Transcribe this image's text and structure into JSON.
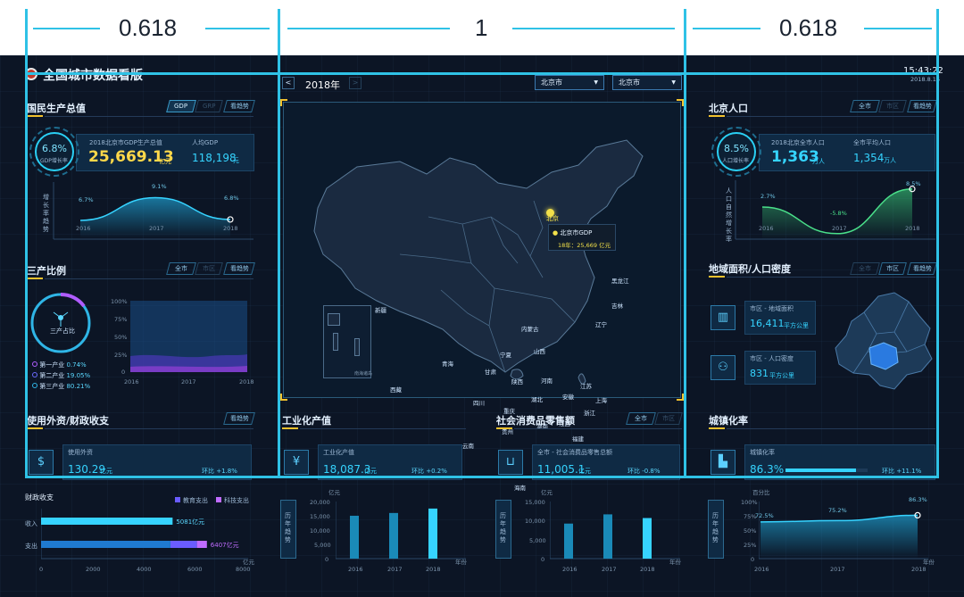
{
  "ratios": {
    "left": "0.618",
    "center": "1",
    "right": "0.618"
  },
  "header": {
    "title": "全国城市数据看版",
    "time": "15:43:22",
    "date": "2018.8.15"
  },
  "year_nav": {
    "year": "2018年",
    "prev": "<",
    "next": ">"
  },
  "selects": [
    {
      "value": "北京市"
    },
    {
      "value": "北京市"
    }
  ],
  "gdp": {
    "title": "国民生产总值",
    "buttons": [
      "GDP",
      "GRP",
      "看趋势"
    ],
    "rate": "6.8%",
    "rate_label": "GDP增长率",
    "total_label": "2018北京市GDP生产总值",
    "total": "25,669.13",
    "total_unit": "亿元",
    "per_label": "人均GDP",
    "per": "118,198",
    "per_unit": "元",
    "trend_label": "增长率趋势"
  },
  "gdp_trend": {
    "type": "area",
    "x": [
      "2016",
      "2017",
      "2018"
    ],
    "values": [
      6.7,
      9.1,
      6.8
    ],
    "labels": [
      "6.7%",
      "9.1%",
      "6.8%"
    ]
  },
  "industry": {
    "title": "三产比例",
    "buttons": [
      "全市",
      "市区",
      "看趋势"
    ],
    "center_label": "三产占比",
    "legend": [
      {
        "name": "第一产业",
        "value": "0.74%",
        "color": "#b05cff"
      },
      {
        "name": "第二产业",
        "value": "19.05%",
        "color": "#6a6aff"
      },
      {
        "name": "第三产业",
        "value": "80.21%",
        "color": "#2fb5e6"
      }
    ]
  },
  "industry_chart": {
    "type": "area",
    "x": [
      "2016",
      "2017",
      "2018"
    ],
    "yticks": [
      "100%",
      "75%",
      "50%",
      "25%",
      "0"
    ]
  },
  "foreign": {
    "title": "使用外资/财政收支",
    "button": "看趋势",
    "label": "使用外资",
    "value": "130.29",
    "unit": "亿元",
    "change": "环比 +1.8%"
  },
  "finance": {
    "title": "财政收支",
    "legend": [
      "教育支出",
      "科技支出"
    ],
    "rows": [
      {
        "name": "收入",
        "value": 5081,
        "label": "5081亿元"
      },
      {
        "name": "支出",
        "value": 6407,
        "label": "6407亿元"
      }
    ],
    "xticks": [
      "0",
      "2000",
      "4000",
      "6000",
      "8000"
    ],
    "unit": "亿元"
  },
  "industrial": {
    "title": "工业化产值",
    "label": "工业化产值",
    "value": "18,087.3",
    "unit": "亿元",
    "change": "环比 +0.2%",
    "trend_label": "历年趋势"
  },
  "industrial_chart": {
    "type": "bar",
    "unit": "亿元",
    "categories": [
      "2016",
      "2017",
      "2018"
    ],
    "values": [
      15500,
      16500,
      18100
    ],
    "yticks": [
      "20,000",
      "15,000",
      "10,000",
      "5,000",
      "0"
    ],
    "ylim": [
      0,
      20000
    ],
    "xunit": "年份"
  },
  "consumer": {
    "title": "社会消费品零售额",
    "buttons": [
      "全市",
      "市区"
    ],
    "label": "全市 - 社会消费品零售总额",
    "value": "11,005.1",
    "unit": "亿元",
    "change": "环比 -0.8%",
    "trend_label": "历年趋势"
  },
  "consumer_chart": {
    "type": "bar",
    "unit": "亿元",
    "categories": [
      "2016",
      "2017",
      "2018"
    ],
    "values": [
      9500,
      12000,
      11000
    ],
    "yticks": [
      "15,000",
      "10,000",
      "5,000",
      "0"
    ],
    "ylim": [
      0,
      15000
    ],
    "xunit": "年份"
  },
  "population": {
    "title": "北京人口",
    "buttons": [
      "全市",
      "市区",
      "看趋势"
    ],
    "rate": "8.5%",
    "rate_label": "人口增长率",
    "total_label": "2018北京全市人口",
    "total": "1,363",
    "total_unit": "万人",
    "avg_label": "全市平均人口",
    "avg": "1,354",
    "avg_unit": "万人",
    "trend_label": "人口自然增长率"
  },
  "pop_trend": {
    "type": "line",
    "x": [
      "2016",
      "2017",
      "2018"
    ],
    "values": [
      2.7,
      -5.8,
      8.5
    ],
    "labels": [
      "2.7%",
      "-5.8%",
      "8.5%"
    ]
  },
  "area": {
    "title": "地域面积/人口密度",
    "buttons": [
      "全市",
      "市区",
      "看趋势"
    ],
    "area_label": "市区 - 地域面积",
    "area_value": "16,411",
    "area_unit": "平方公里",
    "density_label": "市区 - 人口密度",
    "density_value": "831",
    "density_unit": "平方公里"
  },
  "urban": {
    "title": "城镇化率",
    "label": "城镇化率",
    "value": "86.3%",
    "change": "环比 +11.1%",
    "progress": 0.863
  },
  "urban_chart": {
    "type": "area",
    "unit": "百分比",
    "x": [
      "2016",
      "2017",
      "2018"
    ],
    "values": [
      72.5,
      75.2,
      86.3
    ],
    "labels": [
      "72.5%",
      "75.2%",
      "86.3%"
    ],
    "yticks": [
      "100%",
      "75%",
      "50%",
      "25%",
      "0"
    ],
    "xunit": "年份"
  },
  "map": {
    "tooltip_city": "北京",
    "tooltip_title": "北京市GDP",
    "tooltip_value": "18年：25,669 亿元",
    "inset_label": "南海诸岛",
    "provinces": [
      {
        "n": "新疆",
        "x": 420,
        "y": 218
      },
      {
        "n": "西藏",
        "x": 437,
        "y": 307
      },
      {
        "n": "青海",
        "x": 495,
        "y": 278
      },
      {
        "n": "甘肃",
        "x": 543,
        "y": 287
      },
      {
        "n": "内蒙古",
        "x": 584,
        "y": 239
      },
      {
        "n": "宁夏",
        "x": 560,
        "y": 268
      },
      {
        "n": "山西",
        "x": 598,
        "y": 264
      },
      {
        "n": "陕西",
        "x": 573,
        "y": 298
      },
      {
        "n": "四川",
        "x": 530,
        "y": 322
      },
      {
        "n": "重庆",
        "x": 564,
        "y": 331
      },
      {
        "n": "湖北",
        "x": 595,
        "y": 318
      },
      {
        "n": "河南",
        "x": 606,
        "y": 297
      },
      {
        "n": "安徽",
        "x": 630,
        "y": 315
      },
      {
        "n": "江苏",
        "x": 650,
        "y": 303
      },
      {
        "n": "上海",
        "x": 667,
        "y": 319
      },
      {
        "n": "浙江",
        "x": 654,
        "y": 333
      },
      {
        "n": "湖南",
        "x": 601,
        "y": 348
      },
      {
        "n": "江西",
        "x": 626,
        "y": 345
      },
      {
        "n": "福建",
        "x": 641,
        "y": 362
      },
      {
        "n": "贵州",
        "x": 562,
        "y": 354
      },
      {
        "n": "云南",
        "x": 518,
        "y": 370
      },
      {
        "n": "广西",
        "x": 571,
        "y": 381
      },
      {
        "n": "广东",
        "x": 606,
        "y": 380
      },
      {
        "n": "澳门",
        "x": 607,
        "y": 399
      },
      {
        "n": "香港",
        "x": 618,
        "y": 392
      },
      {
        "n": "台湾",
        "x": 664,
        "y": 378
      },
      {
        "n": "海南",
        "x": 576,
        "y": 417
      },
      {
        "n": "辽宁",
        "x": 667,
        "y": 234
      },
      {
        "n": "吉林",
        "x": 685,
        "y": 213
      },
      {
        "n": "黑龙江",
        "x": 685,
        "y": 185
      }
    ]
  }
}
